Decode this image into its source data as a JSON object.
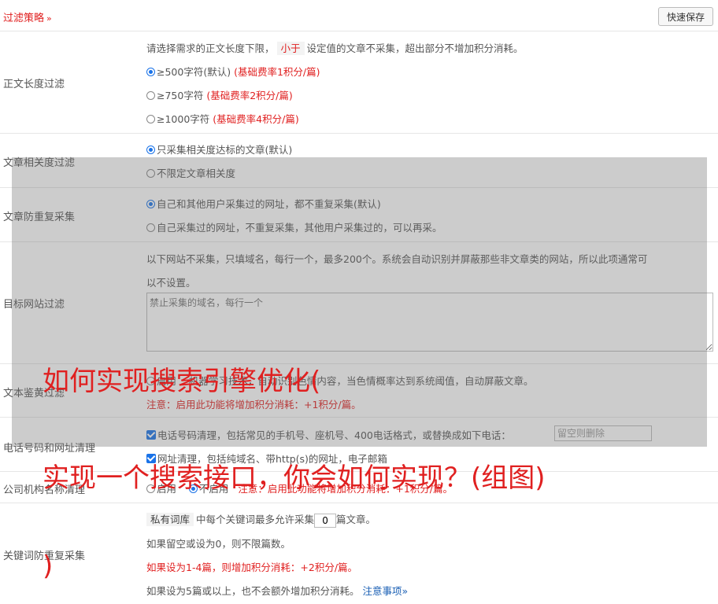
{
  "header": {
    "title": "过滤策略",
    "chevron": "»",
    "save_label": "快速保存"
  },
  "length_filter": {
    "label": "正文长度过滤",
    "intro_pre": "请选择需求的正文长度下限，",
    "intro_tag": "小于",
    "intro_post": "设定值的文章不采集，超出部分不增加积分消耗。",
    "options": [
      {
        "text": "≥500字符(默认)",
        "note": "(基础费率1积分/篇)"
      },
      {
        "text": "≥750字符",
        "note": "(基础费率2积分/篇)"
      },
      {
        "text": "≥1000字符",
        "note": "(基础费率4积分/篇)"
      }
    ]
  },
  "relevance_filter": {
    "label": "文章相关度过滤",
    "options": [
      "只采集相关度达标的文章(默认)",
      "不限定文章相关度"
    ]
  },
  "dedupe": {
    "label": "文章防重复采集",
    "options": [
      "自己和其他用户采集过的网址，都不重复采集(默认)",
      "自己采集过的网址，不重复采集，其他用户采集过的，可以再采。"
    ]
  },
  "target_site": {
    "label": "目标网站过滤",
    "desc_line1": "以下网站不采集，只填域名，每行一个，最多200个。系统会自动识别并屏蔽那些非文章类的网站，所以此项通常可",
    "desc_line2": "以不设置。",
    "placeholder": "禁止采集的域名，每行一个"
  },
  "text_review": {
    "label": "文本鉴黄过滤",
    "option": "启用",
    "desc_mid": "机器学习技术，自动识别色情内容",
    "desc": "，当色情概率达到系统阈值，自动屏蔽文章。",
    "note": "注意：启用此功能将增加积分消耗：+1积分/篇。"
  },
  "phone_url": {
    "label": "电话号码和网址清理",
    "phone_text": "电话号码清理，包括常见的手机号、座机号、400电话格式，或替换成如下电话：",
    "phone_placeholder": "留空则删除",
    "url_text": "网址清理，包括纯域名、带http(s)的网址，电子邮箱"
  },
  "company": {
    "label": "公司机构名称清理",
    "enable": "启用",
    "disable": "不启用",
    "note": "注意：启用此功能将增加积分消耗：+1积分/篇。"
  },
  "keyword_dedupe": {
    "label": "关键词防重复采集",
    "tag": "私有词库",
    "text_pre": "中每个关键词最多允许采集",
    "count": "0",
    "text_post": "篇文章。",
    "line2": "如果留空或设为0，则不限篇数。",
    "line3": "如果设为1-4篇，则增加积分消耗：+2积分/篇。",
    "line4": "如果设为5篇或以上，也不会额外增加积分消耗。",
    "link": "注意事项",
    "link_chevron": "»"
  },
  "watermark": {
    "line1": "如何实现搜索引擎优化(",
    "line2": "实现一个搜索接口，你会如何实现？(组图)",
    "line3": ")"
  }
}
